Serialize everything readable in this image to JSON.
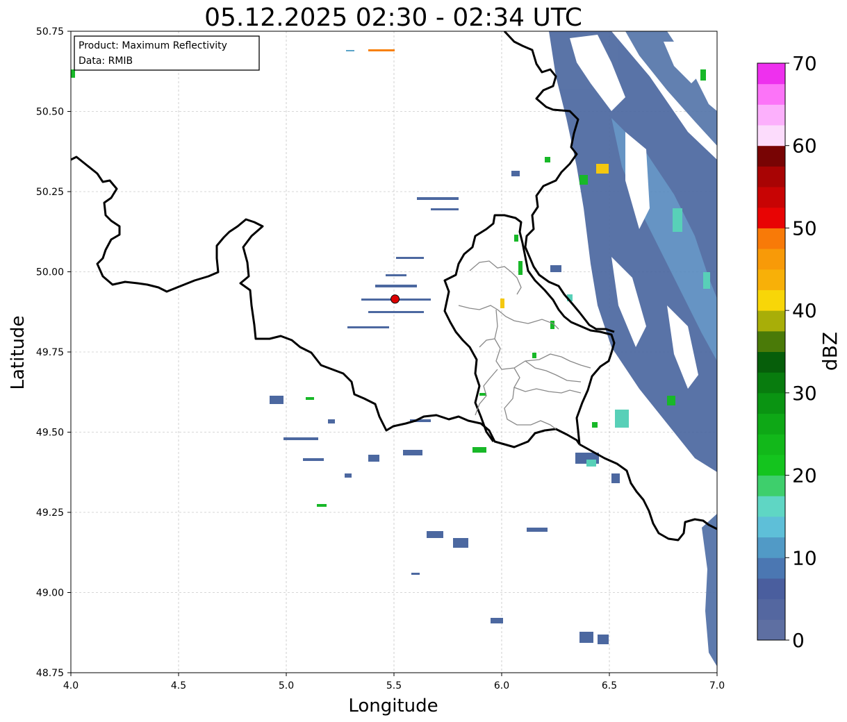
{
  "title": "05.12.2025 02:30 - 02:34 UTC",
  "info_box": {
    "product": "Product: Maximum Reflectivity",
    "data": "Data: RMIB"
  },
  "axes": {
    "xlabel": "Longitude",
    "ylabel": "Latitude",
    "xlim": [
      4.0,
      7.0
    ],
    "ylim": [
      48.75,
      50.75
    ],
    "xticks": [
      "4.0",
      "4.5",
      "5.0",
      "5.5",
      "6.0",
      "6.5",
      "7.0"
    ],
    "yticks": [
      "50.75",
      "50.50",
      "50.25",
      "50.00",
      "49.75",
      "49.50",
      "49.25",
      "49.00",
      "48.75"
    ],
    "grid": true
  },
  "radar_site": {
    "lon": 5.505,
    "lat": 49.915,
    "color": "#dd0000"
  },
  "colorbar": {
    "label": "dBZ",
    "min": 0,
    "max": 70,
    "ticks": [
      "0",
      "10",
      "20",
      "30",
      "40",
      "50",
      "60",
      "70"
    ],
    "colors": [
      "#5e6fa2",
      "#5467a0",
      "#4a5e9e",
      "#4b77b2",
      "#519ac6",
      "#5ebfd8",
      "#5fd6c4",
      "#3ecf6c",
      "#14c41e",
      "#12b81a",
      "#0ea816",
      "#0a9412",
      "#087c0e",
      "#065e0a",
      "#4a7a08",
      "#a8ae08",
      "#f8d608",
      "#f8b008",
      "#f89a08",
      "#f87a08",
      "#e80404",
      "#c80404",
      "#a80404",
      "#780404",
      "#fcdcfc",
      "#fcb0fc",
      "#fc74f8",
      "#ee30ee"
    ]
  },
  "echo_colors": {
    "weak": "#4c68a0",
    "light": "#5aa3c8",
    "teal": "#58d0b8",
    "green": "#18b828",
    "yellow": "#f4c810",
    "orange": "#f88008"
  }
}
